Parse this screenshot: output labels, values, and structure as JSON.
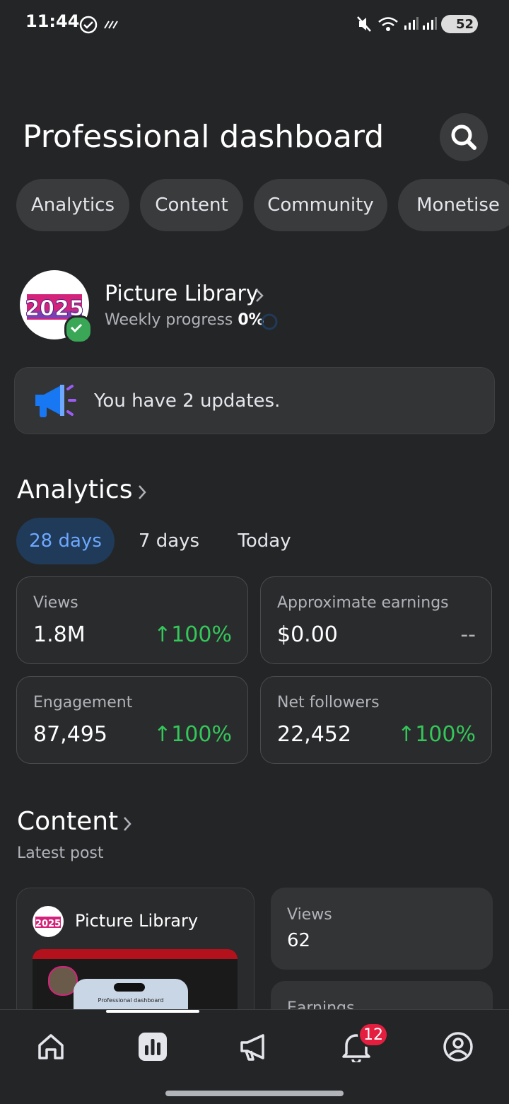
{
  "status_bar": {
    "time": "11:44",
    "battery": "52"
  },
  "header": {
    "title": "Professional dashboard"
  },
  "tabs": [
    "Analytics",
    "Content",
    "Community",
    "Monetise"
  ],
  "profile": {
    "name": "Picture Library",
    "weekly_label": "Weekly progress",
    "weekly_value": "0%",
    "avatar_text": "2025"
  },
  "updates": {
    "text": "You have 2 updates."
  },
  "analytics": {
    "title": "Analytics",
    "ranges": [
      "28 days",
      "7 days",
      "Today"
    ],
    "selected_range": "28 days",
    "stats": [
      {
        "label": "Views",
        "value": "1.8M",
        "change": "100%"
      },
      {
        "label": "Approximate earnings",
        "value": "$0.00",
        "change": "--"
      },
      {
        "label": "Engagement",
        "value": "87,495",
        "change": "100%"
      },
      {
        "label": "Net followers",
        "value": "22,452",
        "change": "100%"
      }
    ]
  },
  "content": {
    "title": "Content",
    "subtitle": "Latest post",
    "post_author": "Picture Library",
    "thumb_inner_title": "Professional dashboard",
    "metrics": [
      {
        "label": "Views",
        "value": "62"
      },
      {
        "label": "Earnings",
        "value": ""
      }
    ]
  },
  "bottom_nav": {
    "items": [
      "home-icon",
      "dashboard-icon",
      "megaphone-icon",
      "bell-icon",
      "profile-icon"
    ],
    "notification_count": "12"
  },
  "colors": {
    "accent": "#6ca8ff",
    "positive": "#34c759",
    "badge": "#e41e3f"
  }
}
